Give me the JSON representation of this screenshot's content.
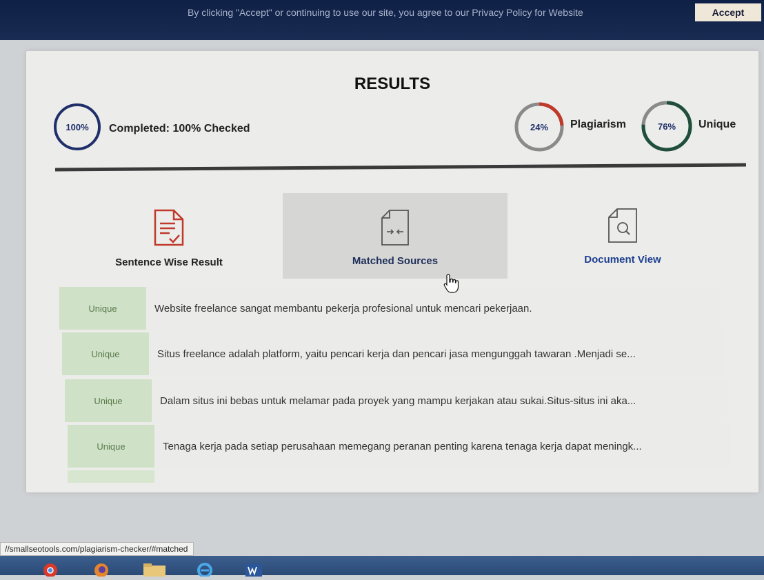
{
  "cookie_banner": {
    "text": "By clicking \"Accept\" or continuing to use our site, you agree to our Privacy Policy for Website",
    "accept_label": "Accept"
  },
  "results": {
    "title": "RESULTS",
    "completed": {
      "percent_text": "100%",
      "value": 100,
      "label": "Completed: 100% Checked"
    },
    "plagiarism": {
      "percent_text": "24%",
      "value": 24,
      "label": "Plagiarism",
      "color": "#c0392b"
    },
    "unique": {
      "percent_text": "76%",
      "value": 76,
      "label": "Unique",
      "color": "#1f4f3a"
    }
  },
  "tabs": [
    {
      "label": "Sentence Wise Result",
      "icon": "checklist-document-icon",
      "active": false,
      "color": "#111111"
    },
    {
      "label": "Matched Sources",
      "icon": "compare-document-icon",
      "active": true,
      "color": "#1f2f5a"
    },
    {
      "label": "Document View",
      "icon": "search-document-icon",
      "active": false,
      "color": "#1d3f8f"
    }
  ],
  "sentences": [
    {
      "status": "Unique",
      "text": "Website freelance sangat membantu pekerja profesional untuk mencari pekerjaan."
    },
    {
      "status": "Unique",
      "text": "Situs freelance adalah platform, yaitu pencari kerja dan pencari jasa mengunggah tawaran .Menjadi se..."
    },
    {
      "status": "Unique",
      "text": "Dalam situs ini bebas untuk melamar pada proyek yang mampu kerjakan atau sukai.Situs-situs ini aka..."
    },
    {
      "status": "Unique",
      "text": "Tenaga kerja pada setiap perusahaan memegang peranan penting karena tenaga kerja dapat meningk..."
    }
  ],
  "status_bar": {
    "url": "//smallseotools.com/plagiarism-checker/#matched"
  },
  "taskbar": {
    "icons": [
      "chrome-icon",
      "firefox-icon",
      "file-explorer-icon",
      "internet-explorer-icon",
      "word-icon"
    ]
  },
  "colors": {
    "unique_badge_bg": "#cfe1c6",
    "unique_badge_text": "#5a7a4c",
    "ring_track": "#8a8a8a",
    "completed_ring": "#1f2f6a"
  }
}
